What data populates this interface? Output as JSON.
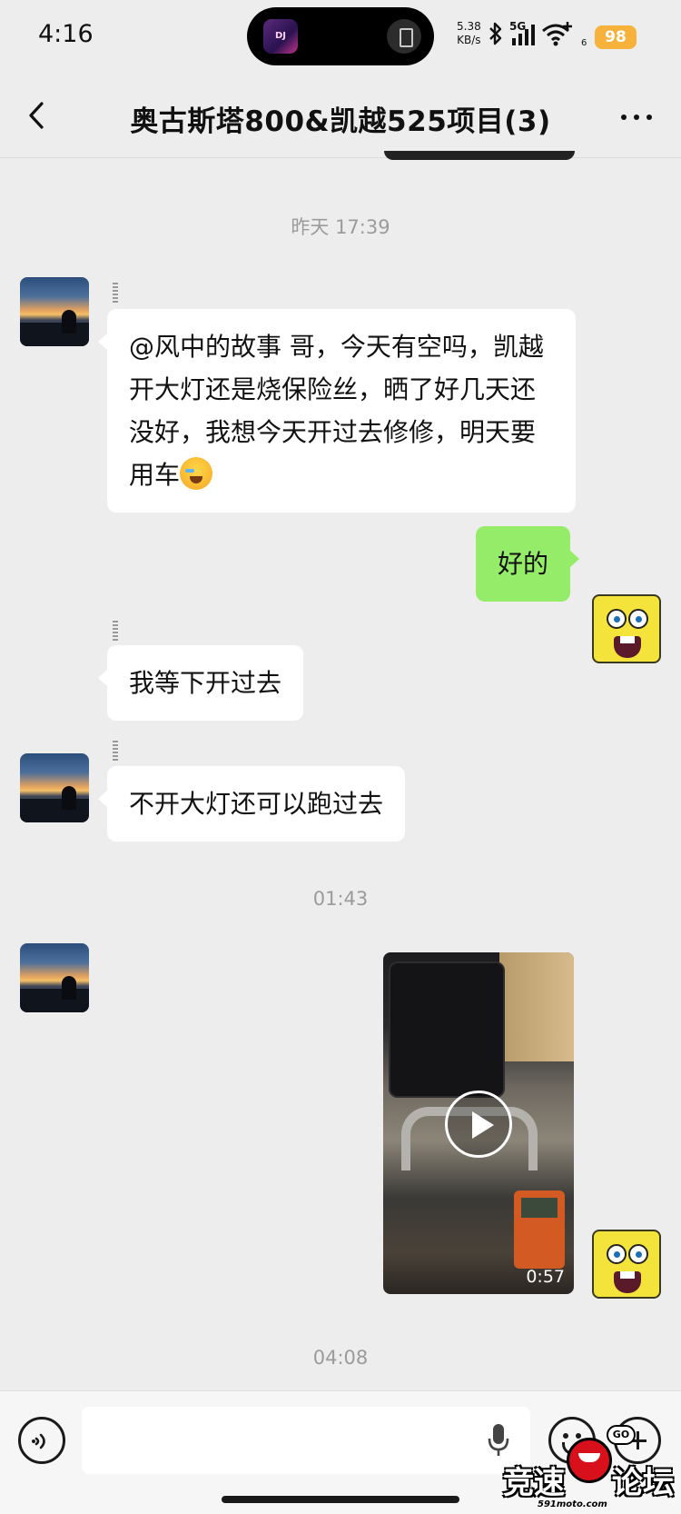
{
  "status_bar": {
    "time": "4:16",
    "net_speed_value": "5.38",
    "net_speed_unit": "KB/s",
    "signal_type": "5G",
    "wifi_sub": "6",
    "battery": "98",
    "island_app_label": "DJ",
    "accent_battery": "#f6b23a"
  },
  "nav": {
    "title": "奥古斯塔800&凯越525项目(3)"
  },
  "timestamps": {
    "t1": "昨天 17:39",
    "t2": "01:43",
    "t3": "04:08"
  },
  "messages": {
    "m1_text": "@风中的故事  哥，今天有空吗，凯越开大灯还是烧保险丝，晒了好几天还没好，我想今天开过去修修，明天要用车",
    "m2_text": "好的",
    "m3_text": "我等下开过去",
    "m4_text": "不开大灯还可以跑过去",
    "video_duration": "0:57"
  },
  "colors": {
    "background": "#ededed",
    "bubble_self": "#95ec69",
    "bubble_other": "#ffffff"
  },
  "watermark": {
    "left_text": "竞速",
    "right_text": "论坛",
    "site": "591moto.com",
    "badge": "GO"
  }
}
